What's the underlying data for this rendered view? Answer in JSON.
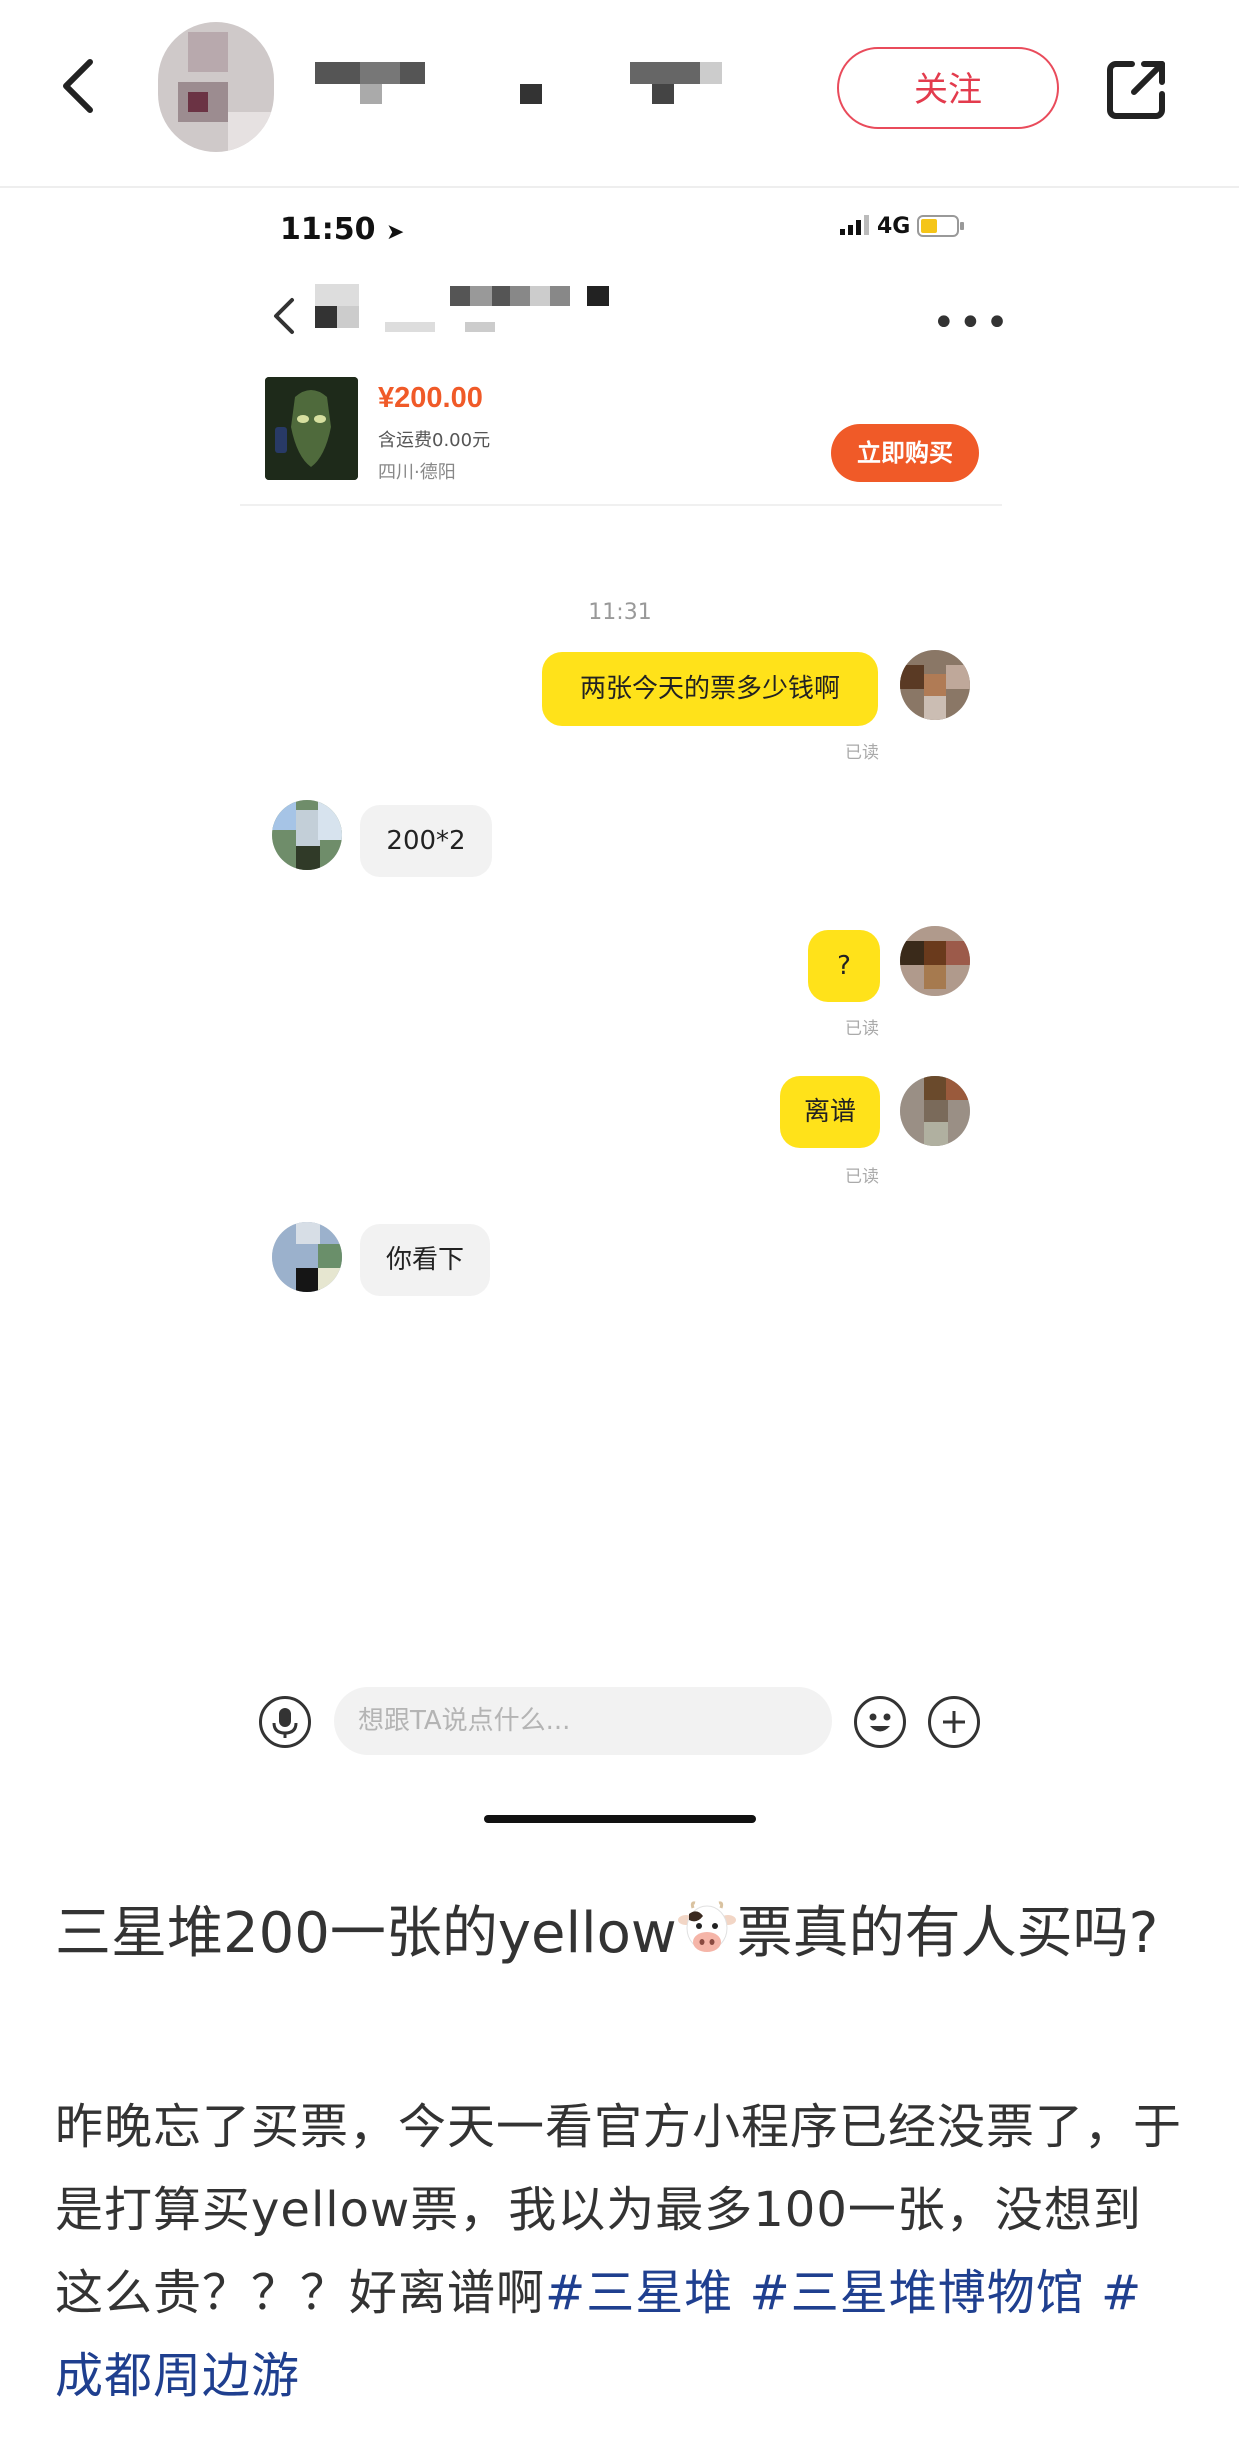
{
  "header": {
    "follow_label": "关注"
  },
  "status_bar": {
    "time": "11:50",
    "network": "4G"
  },
  "product": {
    "price": "¥200.00",
    "shipping": "含运费0.00元",
    "location": "四川·德阳",
    "buy_label": "立即购买"
  },
  "chat": {
    "timestamp": "11:31",
    "messages": [
      {
        "side": "right",
        "text": "两张今天的票多少钱啊",
        "status": "已读"
      },
      {
        "side": "left",
        "text": "200*2"
      },
      {
        "side": "right",
        "text": "?",
        "status": "已读"
      },
      {
        "side": "right",
        "text": "离谱",
        "status": "已读"
      },
      {
        "side": "left",
        "text": "你看下"
      }
    ],
    "input_placeholder": "想跟TA说点什么..."
  },
  "post": {
    "title_before": "三星堆200一张的yellow",
    "title_after": "票真的有人买吗?",
    "body_text": "昨晚忘了买票，今天一看官方小程序已经没票了，于是打算买yellow票，我以为最多100一张，没想到这么贵？？？好离谱啊",
    "tags": [
      "#三星堆",
      "#三星堆博物馆",
      "#成都周边游"
    ]
  },
  "colors": {
    "follow_red": "#e33b4d",
    "bubble_yellow": "#ffe21a",
    "buy_orange": "#f05a28",
    "tag_blue": "#1f3f8f"
  }
}
